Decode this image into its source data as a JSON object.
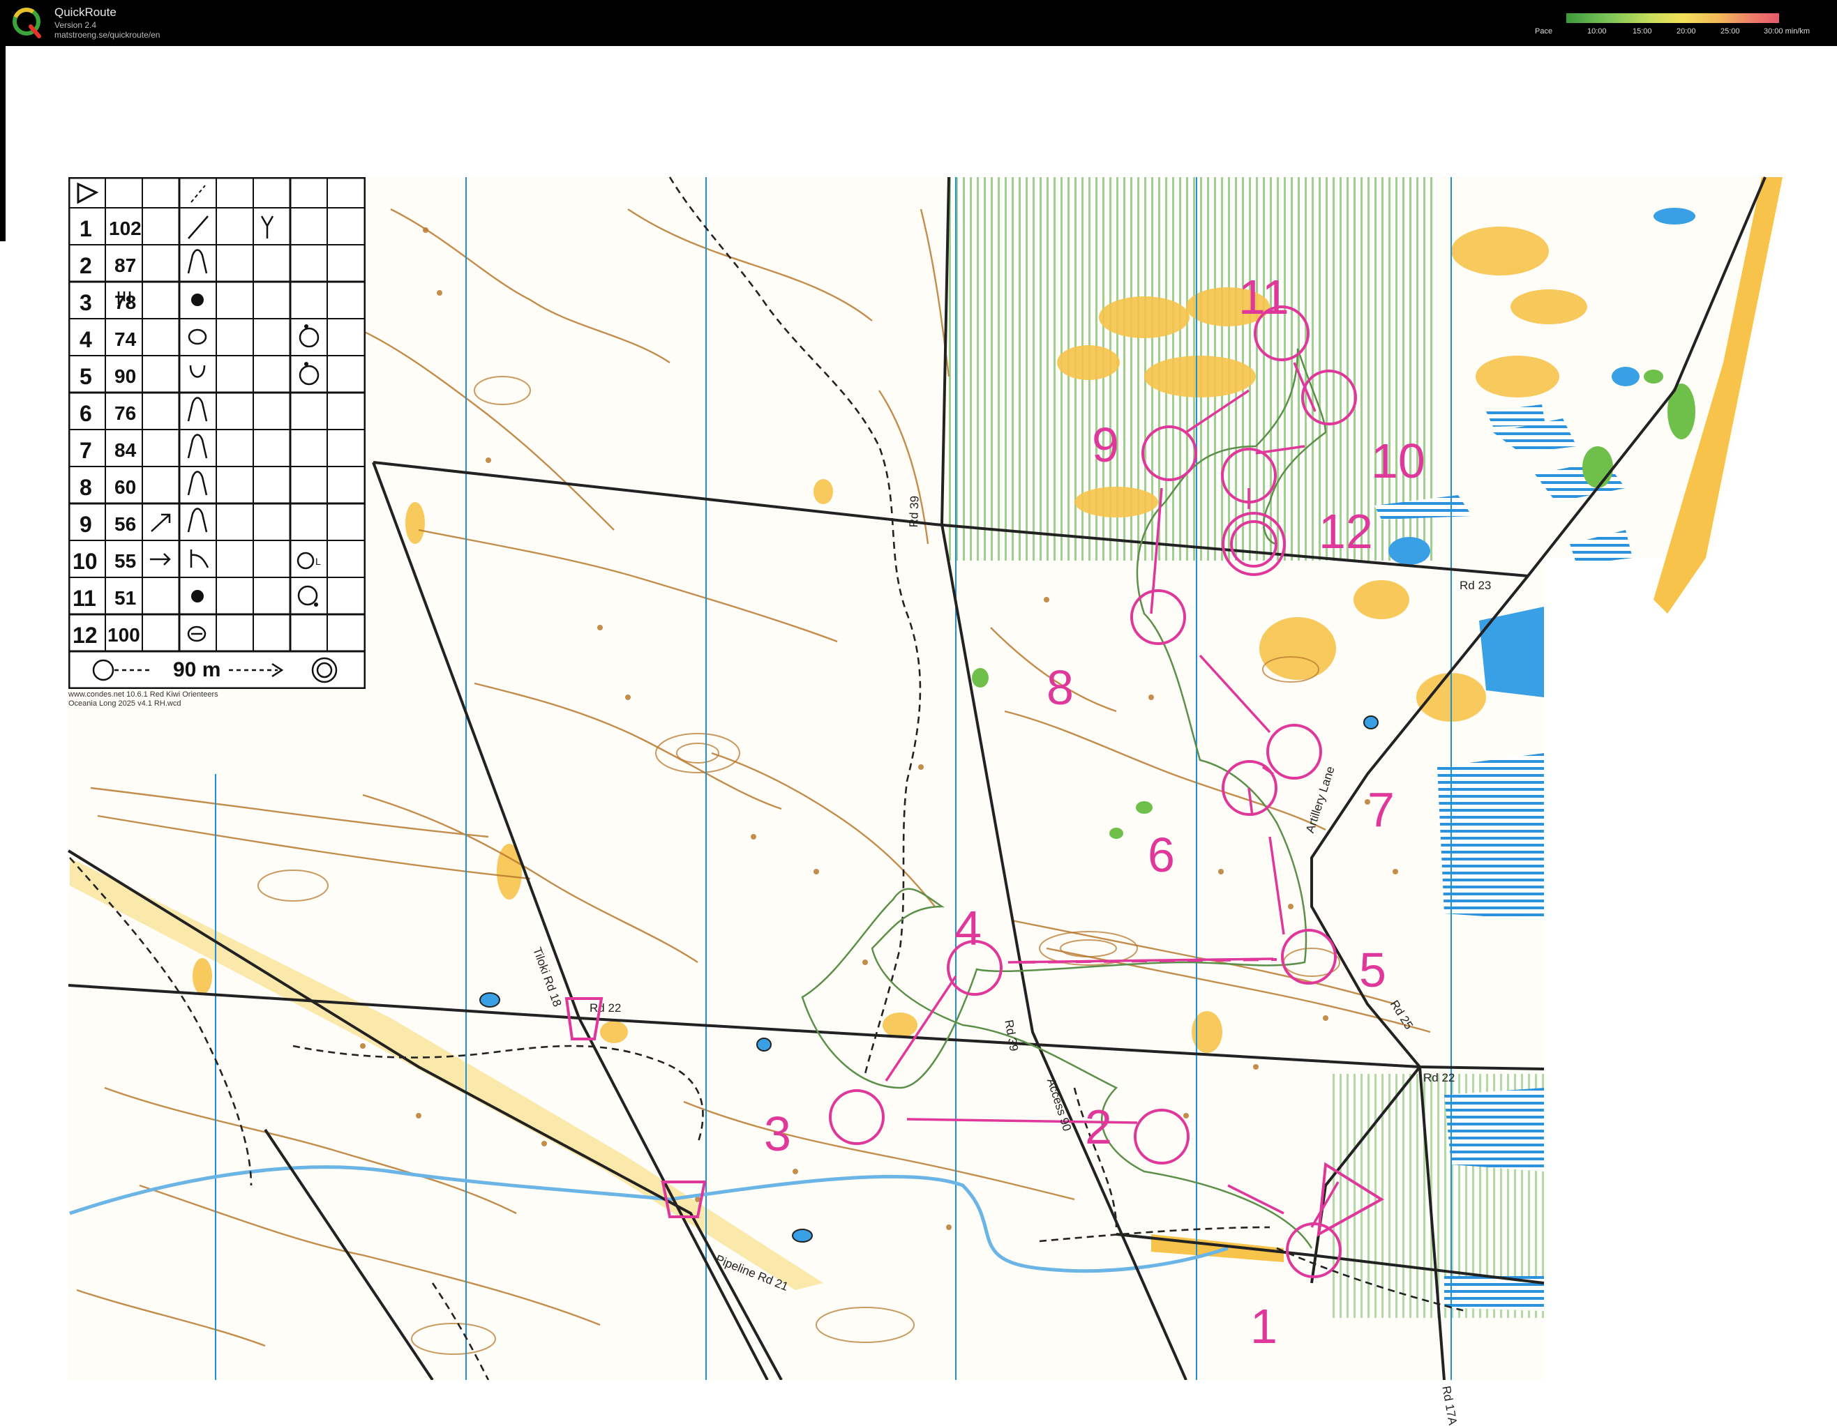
{
  "app": {
    "title": "QuickRoute",
    "version": "Version 2.4",
    "url": "matstroeng.se/quickroute/en"
  },
  "pace_legend": {
    "label": "Pace",
    "ticks": [
      "10:00",
      "15:00",
      "20:00",
      "25:00",
      "30:00 min/km"
    ]
  },
  "description_table": {
    "rows": [
      {
        "num": "1",
        "code": "102"
      },
      {
        "num": "2",
        "code": "87"
      },
      {
        "num": "3",
        "code": "78"
      },
      {
        "num": "4",
        "code": "74"
      },
      {
        "num": "5",
        "code": "90"
      },
      {
        "num": "6",
        "code": "76"
      },
      {
        "num": "7",
        "code": "84"
      },
      {
        "num": "8",
        "code": "60"
      },
      {
        "num": "9",
        "code": "56"
      },
      {
        "num": "10",
        "code": "55"
      },
      {
        "num": "11",
        "code": "51"
      },
      {
        "num": "12",
        "code": "100"
      }
    ],
    "finish_distance": "90 m"
  },
  "credit": {
    "line1": "www.condes.net 10.6.1 Red Kiwi Orienteers",
    "line2": "Oceania Long 2025 v4.1 RH.wcd"
  },
  "controls": [
    {
      "label": "1"
    },
    {
      "label": "2"
    },
    {
      "label": "3"
    },
    {
      "label": "4"
    },
    {
      "label": "5"
    },
    {
      "label": "6"
    },
    {
      "label": "7"
    },
    {
      "label": "8"
    },
    {
      "label": "9"
    },
    {
      "label": "10"
    },
    {
      "label": "11"
    },
    {
      "label": "12"
    }
  ],
  "roads": {
    "rd23": "Rd 23",
    "rd39_top": "Rd 39",
    "rd39_mid": "Rd 39",
    "rd22_left": "Rd 22",
    "rd22_right": "Rd 22",
    "rd25": "Rd 25",
    "tiloki": "Tiloki Rd 18",
    "access": "Access 90",
    "artillery": "Artillery Lane",
    "pipeline": "Pipeline Rd 21",
    "rd17": "Rd 17A"
  },
  "colors": {
    "course": "#e0389a",
    "contour": "#b8792e",
    "yellow": "#f7c34a",
    "water": "#1f8fd8",
    "green": "#6fc04a",
    "road": "#222222"
  }
}
